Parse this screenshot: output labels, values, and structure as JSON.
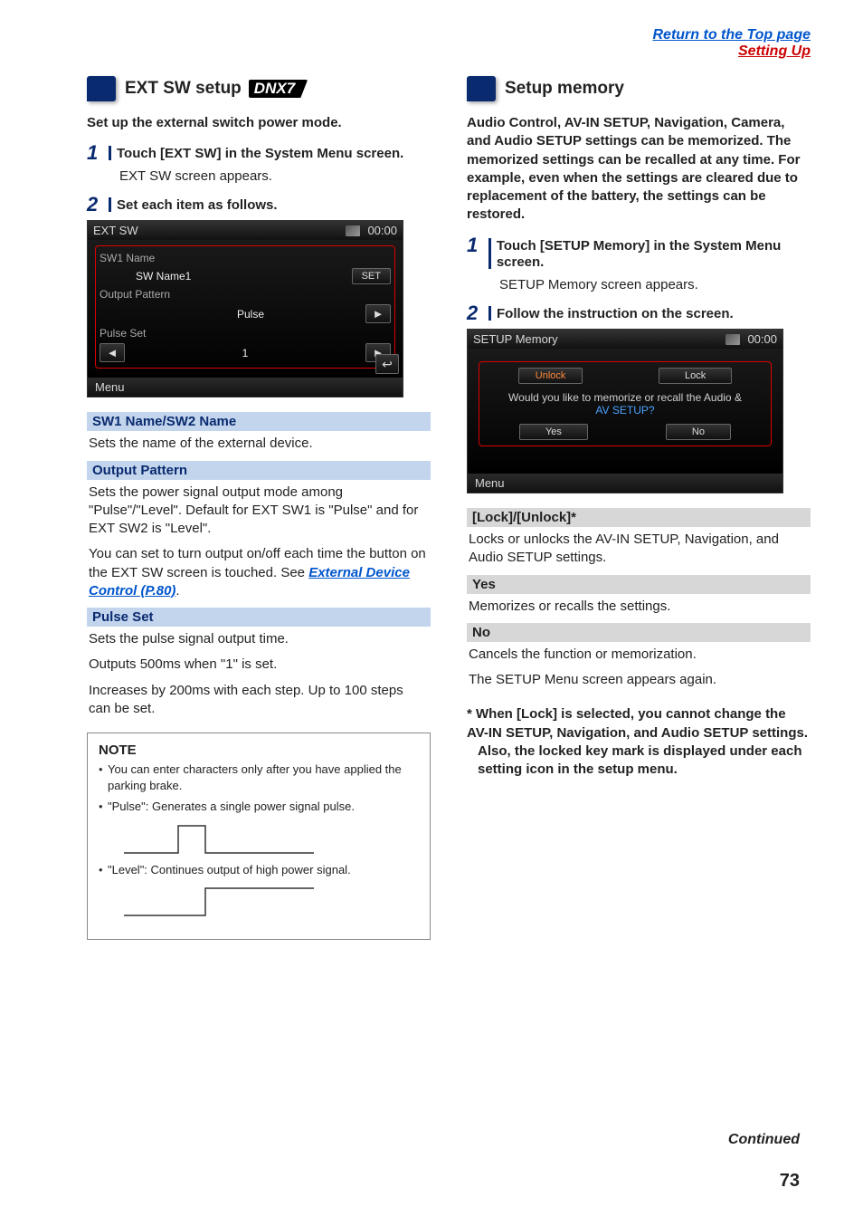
{
  "top_links": {
    "return": "Return to the Top page",
    "setting_up": "Setting Up"
  },
  "left": {
    "title": "EXT SW setup",
    "badge": "DNX7",
    "intro": "Set up the external switch power mode.",
    "step1_label": "Touch [EXT SW] in the System Menu screen.",
    "step1_sub": "EXT SW screen appears.",
    "step2_label": "Set each item as follows.",
    "screenshot": {
      "title": "EXT SW",
      "clock": "00:00",
      "sw1_name_label": "SW1 Name",
      "sw1_name_value": "SW Name1",
      "set_btn": "SET",
      "output_pattern_label": "Output Pattern",
      "output_pattern_value": "Pulse",
      "pulse_set_label": "Pulse Set",
      "pulse_set_value": "1",
      "menu": "Menu"
    },
    "sub1_head": "SW1 Name/SW2 Name",
    "sub1_body": "Sets the name of the external device.",
    "sub2_head": "Output Pattern",
    "sub2_body1": "Sets the power signal output mode among \"Pulse\"/\"Level\". Default for EXT SW1 is \"Pulse\" and for EXT SW2 is \"Level\".",
    "sub2_body2a": "You can set to turn output on/off each time the button on the EXT SW screen is touched. See ",
    "sub2_link": "External Device Control (P.80)",
    "sub2_body2b": ".",
    "sub3_head": "Pulse Set",
    "sub3_body1": "Sets the pulse signal output time.",
    "sub3_body2": "Outputs 500ms when \"1\" is set.",
    "sub3_body3": "Increases by 200ms with each step. Up to 100 steps can be set.",
    "note_title": "NOTE",
    "note1": "You can enter characters only after you have applied the parking brake.",
    "note2": "\"Pulse\": Generates a single power signal pulse.",
    "note3": "\"Level\": Continues output of high power signal."
  },
  "right": {
    "title": "Setup memory",
    "intro": "Audio Control, AV-IN SETUP, Navigation, Camera, and Audio SETUP settings can be memorized. The memorized settings can be recalled at any time. For example, even when the settings are cleared due to replacement of the battery, the settings can be restored.",
    "step1_label": "Touch [SETUP Memory] in the System Menu screen.",
    "step1_sub": "SETUP Memory screen appears.",
    "step2_label": "Follow the instruction on the screen.",
    "screenshot": {
      "title": "SETUP Memory",
      "clock": "00:00",
      "unlock": "Unlock",
      "lock": "Lock",
      "prompt1": "Would you like to memorize or recall the Audio &",
      "prompt2": "AV SETUP?",
      "yes": "Yes",
      "no": "No",
      "menu": "Menu"
    },
    "sub1_head": "[Lock]/[Unlock]*",
    "sub1_body": "Locks or unlocks the AV-IN SETUP, Navigation, and Audio SETUP settings.",
    "sub2_head": "Yes",
    "sub2_body": "Memorizes or recalls the settings.",
    "sub3_head": "No",
    "sub3_body1": "Cancels the function or memorization.",
    "sub3_body2": "The SETUP Menu screen appears again.",
    "footnote1": "* When [Lock] is selected, you cannot change the AV-IN SETUP, Navigation, and Audio SETUP settings.",
    "footnote2": "Also, the locked key mark is displayed under each setting icon in the setup menu."
  },
  "continued": "Continued",
  "page_number": "73"
}
